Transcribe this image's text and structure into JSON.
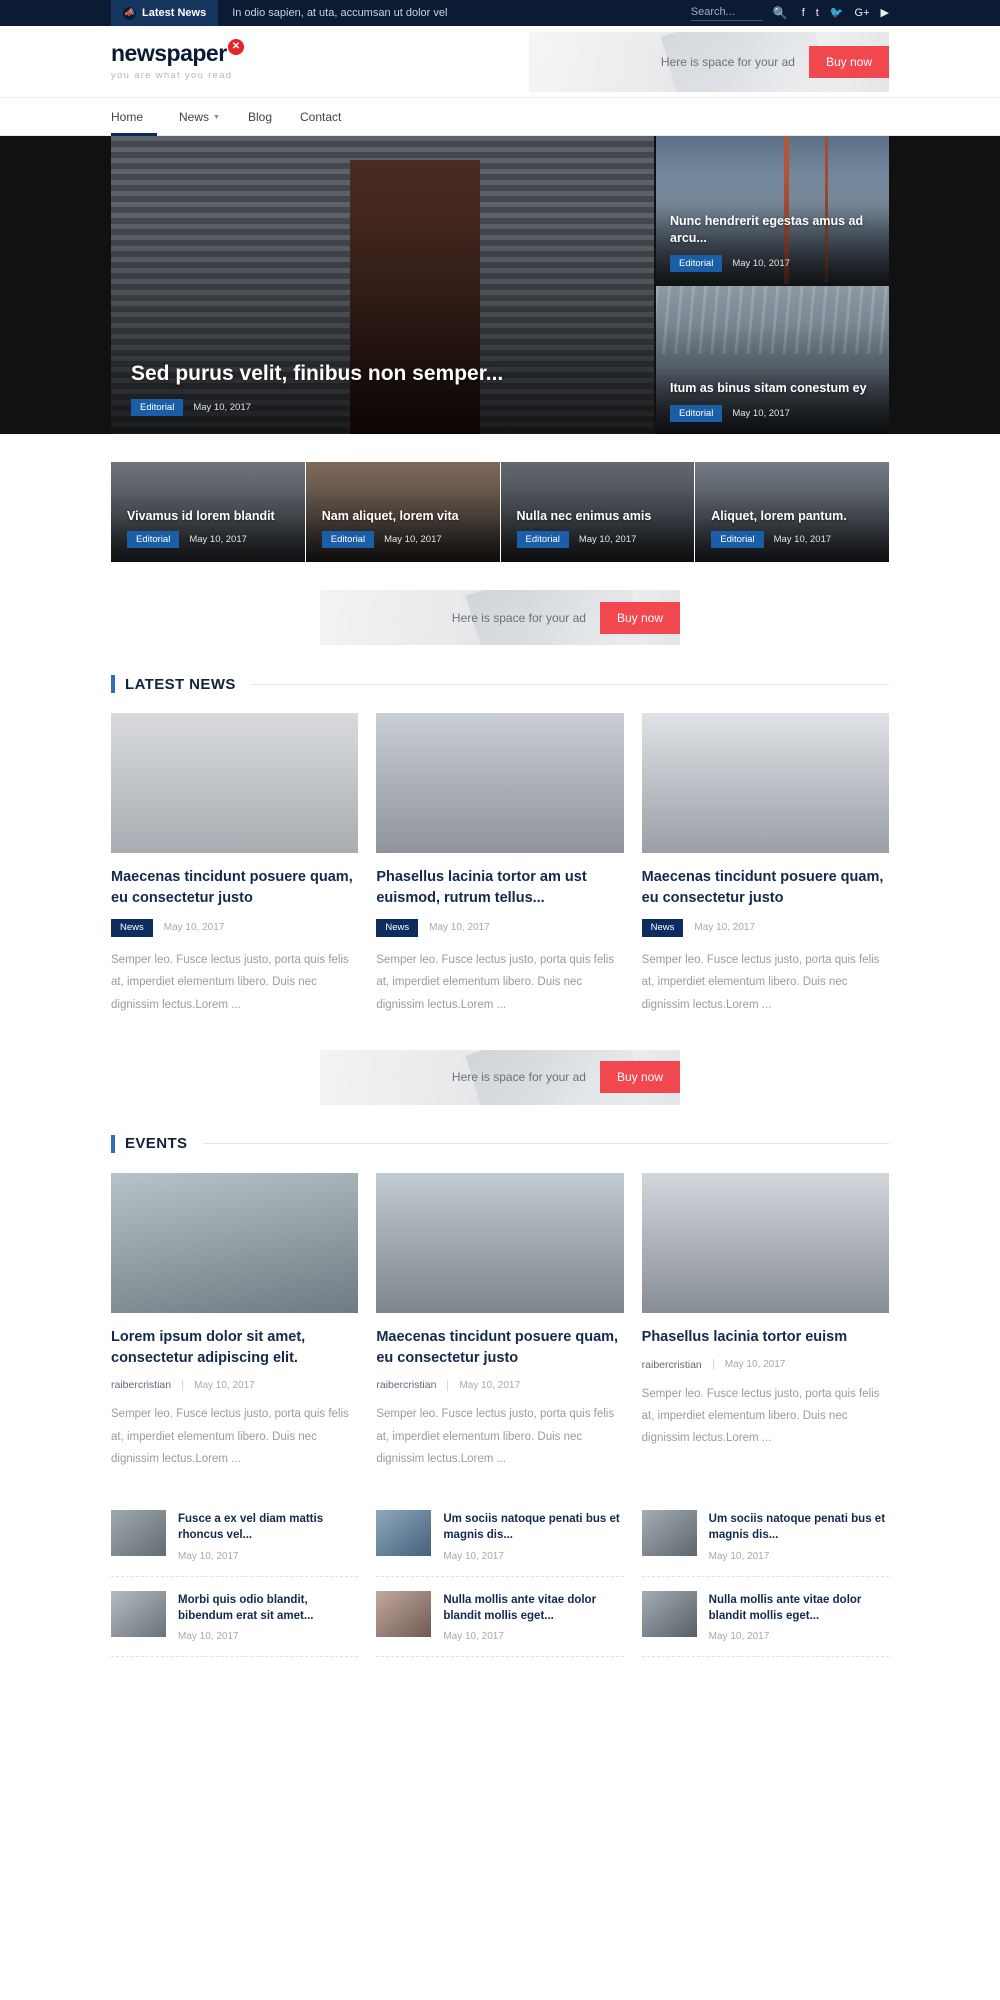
{
  "topbar": {
    "latest_label": "Latest News",
    "megaphone_icon": "megaphone-icon",
    "ticker_text": "In odio sapien, at uta, accumsan ut dolor vel",
    "search_placeholder": "Search...",
    "search_value": "",
    "search_icon": "search-icon",
    "socials": [
      {
        "name": "facebook-icon",
        "glyph": "f"
      },
      {
        "name": "tumblr-icon",
        "glyph": "t"
      },
      {
        "name": "twitter-icon",
        "glyph": "🐦"
      },
      {
        "name": "google-plus-icon",
        "glyph": "G+"
      },
      {
        "name": "youtube-icon",
        "glyph": "▶"
      }
    ]
  },
  "header": {
    "logo_text": "newspaper",
    "logo_mark": "✕",
    "tagline": "you are what you read",
    "accent_red": "#e8232a"
  },
  "ads": {
    "text": "Here is space for your ad",
    "button": "Buy now",
    "button_color": "#f0484e"
  },
  "nav": {
    "items": [
      {
        "label": "Home",
        "active": true,
        "caret": false
      },
      {
        "label": "News",
        "active": false,
        "caret": true
      },
      {
        "label": "Blog",
        "active": false,
        "caret": false
      },
      {
        "label": "Contact",
        "active": false,
        "caret": false
      }
    ],
    "caret_icon": "chevron-down-icon"
  },
  "hero": {
    "main": {
      "title": "Sed purus velit, finibus non semper...",
      "category": "Editorial",
      "date": "May 10, 2017"
    },
    "side": [
      {
        "title": "Nunc hendrerit egestas amus ad arcu...",
        "category": "Editorial",
        "date": "May 10, 2017"
      },
      {
        "title": "Itum as binus sitam conestum ey",
        "category": "Editorial",
        "date": "May 10, 2017"
      }
    ]
  },
  "featured_strip": [
    {
      "title": "Vivamus id lorem blandit",
      "category": "Editorial",
      "date": "May 10, 2017"
    },
    {
      "title": "Nam aliquet, lorem vita",
      "category": "Editorial",
      "date": "May 10, 2017"
    },
    {
      "title": "Nulla nec enimus amis",
      "category": "Editorial",
      "date": "May 10, 2017"
    },
    {
      "title": "Aliquet, lorem pantum.",
      "category": "Editorial",
      "date": "May 10, 2017"
    }
  ],
  "latest_news": {
    "heading": "LATEST NEWS",
    "cards": [
      {
        "title": "Maecenas tincidunt posuere quam, eu consectetur justo",
        "category": "News",
        "date": "May 10, 2017",
        "excerpt": "Semper leo. Fusce lectus justo, porta quis felis at, imperdiet elementum libero. Duis nec dignissim lectus.Lorem ..."
      },
      {
        "title": "Phasellus lacinia tortor am ust euismod, rutrum tellus...",
        "category": "News",
        "date": "May 10, 2017",
        "excerpt": "Semper leo. Fusce lectus justo, porta quis felis at, imperdiet elementum libero. Duis nec dignissim lectus.Lorem ..."
      },
      {
        "title": "Maecenas tincidunt posuere quam, eu consectetur justo",
        "category": "News",
        "date": "May 10, 2017",
        "excerpt": "Semper leo. Fusce lectus justo, porta quis felis at, imperdiet elementum libero. Duis nec dignissim lectus.Lorem ..."
      }
    ]
  },
  "events": {
    "heading": "EVENTS",
    "cards": [
      {
        "title": "Lorem ipsum dolor sit amet, consectetur adipiscing elit.",
        "author": "raibercristian",
        "date": "May 10, 2017",
        "excerpt": "Semper leo. Fusce lectus justo, porta quis felis at, imperdiet elementum libero. Duis nec dignissim lectus.Lorem ..."
      },
      {
        "title": "Maecenas tincidunt posuere quam, eu consectetur justo",
        "author": "raibercristian",
        "date": "May 10, 2017",
        "excerpt": "Semper leo. Fusce lectus justo, porta quis felis at, imperdiet elementum libero. Duis nec dignissim lectus.Lorem ..."
      },
      {
        "title": "Phasellus lacinia tortor euism",
        "author": "raibercristian",
        "date": "May 10, 2017",
        "excerpt": "Semper leo. Fusce lectus justo, porta quis felis at, imperdiet elementum libero. Duis nec dignissim lectus.Lorem ..."
      }
    ],
    "mini_rows": [
      [
        {
          "title": "Fusce a ex vel diam mattis rhoncus vel...",
          "date": "May 10, 2017"
        },
        {
          "title": "Um sociis natoque penati bus et magnis dis...",
          "date": "May 10, 2017"
        },
        {
          "title": "Um sociis natoque penati bus et magnis dis...",
          "date": "May 10, 2017"
        }
      ],
      [
        {
          "title": "Morbi quis odio blandit, bibendum erat sit amet...",
          "date": "May 10, 2017"
        },
        {
          "title": "Nulla mollis ante vitae dolor blandit mollis eget...",
          "date": "May 10, 2017"
        },
        {
          "title": "Nulla mollis ante vitae dolor blandit mollis eget...",
          "date": "May 10, 2017"
        }
      ]
    ]
  }
}
